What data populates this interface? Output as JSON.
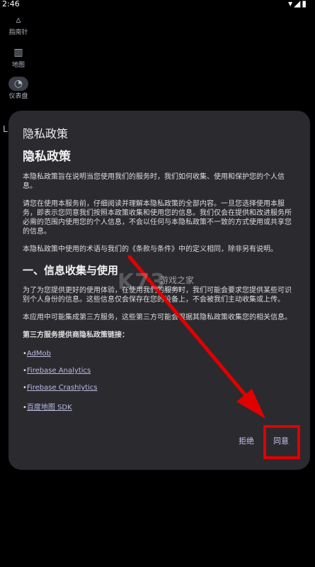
{
  "status_bar": {
    "time": "2:46",
    "icons": "▾◢▮"
  },
  "nav_rail": {
    "items": [
      {
        "label": "指南针",
        "icon": "compass-icon",
        "glyph": "▵"
      },
      {
        "label": "地图",
        "icon": "map-icon",
        "glyph": "▥"
      },
      {
        "label": "仪表盘",
        "icon": "dashboard-icon",
        "glyph": "◔"
      }
    ],
    "peek_text": "L"
  },
  "dialog": {
    "title": "隐私政策",
    "heading": "隐私政策",
    "paragraphs": [
      "本隐私政策旨在说明当您使用我们的服务时，我们如何收集、使用和保护您的个人信息。",
      "请您在使用本服务前，仔细阅读并理解本隐私政策的全部内容。一旦您选择使用本服务，即表示您同意我们按照本政策收集和使用您的信息。我们仅会在提供和改进服务所必需的范围内使用您的个人信息，不会以任何与本隐私政策不一致的方式使用或共享您的信息。",
      "本隐私政策中使用的术语与我们的《条款与条件》中的定义相同，除非另有说明。"
    ],
    "section1_title": "一、信息收集与使用",
    "section1_paragraphs": [
      "为了为您提供更好的使用体验，在使用我们的服务时，我们可能会要求您提供某些可识别个人身份的信息。这些信息仅会保存在您的设备上，不会被我们主动收集或上传。",
      "本应用中可能集成第三方服务，这些第三方可能会根据其隐私政策收集您的相关信息。"
    ],
    "third_party_heading": "第三方服务提供商隐私政策链接：",
    "links": [
      "AdMob",
      "Firebase Analytics",
      "Firebase Crashlytics",
      "百度地图 SDK"
    ],
    "reject_label": "拒绝",
    "agree_label": "同意"
  },
  "watermark": {
    "logo": "K73",
    "name": "游戏之家",
    "url": ".com"
  },
  "colors": {
    "annotation_red": "#e10000",
    "dialog_bg": "#2b2a2f",
    "button_text": "#c9c2ef"
  }
}
